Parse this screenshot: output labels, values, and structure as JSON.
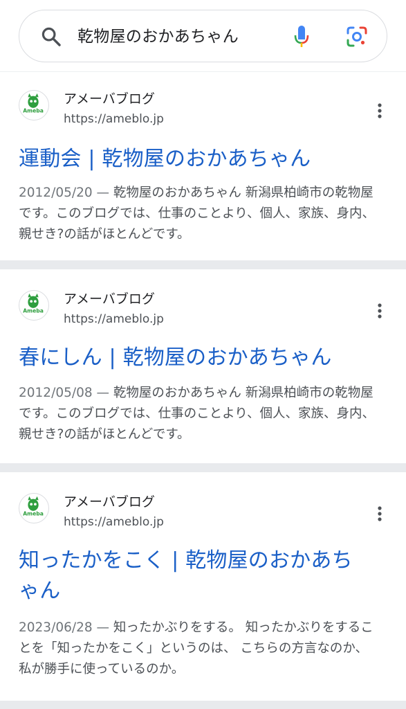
{
  "search": {
    "query": "乾物屋のおかあちゃん",
    "icons": {
      "search": "search-icon",
      "mic": "mic-icon",
      "lens": "google-lens-icon"
    },
    "colors": {
      "blue": "#4285f4",
      "red": "#ea4335",
      "yellow": "#fbbc04",
      "green": "#34a853"
    }
  },
  "results": [
    {
      "site_name": "アメーバブログ",
      "site_url": "https://ameblo.jp",
      "title": "運動会 | 乾物屋のおかあちゃん",
      "date": "2012/05/20 — ",
      "snippet": "乾物屋のおかあちゃん 新潟県柏崎市の乾物屋です。このブログでは、仕事のことより、個人、家族、身内、親せき?の話がほとんどです。"
    },
    {
      "site_name": "アメーバブログ",
      "site_url": "https://ameblo.jp",
      "title": "春にしん | 乾物屋のおかあちゃん",
      "date": "2012/05/08 — ",
      "snippet": "乾物屋のおかあちゃん 新潟県柏崎市の乾物屋です。このブログでは、仕事のことより、個人、家族、身内、親せき?の話がほとんどです。"
    },
    {
      "site_name": "アメーバブログ",
      "site_url": "https://ameblo.jp",
      "title": "知ったかをこく | 乾物屋のおかあちゃん",
      "date": "2023/06/28 — ",
      "snippet": "知ったかぶりをする。 知ったかぶりをすることを「知ったかをこく」というのは、 こちらの方言なのか、 私が勝手に使っているのか。"
    }
  ],
  "favicon_label": "Ameba",
  "link_color": "#1a5fc7"
}
